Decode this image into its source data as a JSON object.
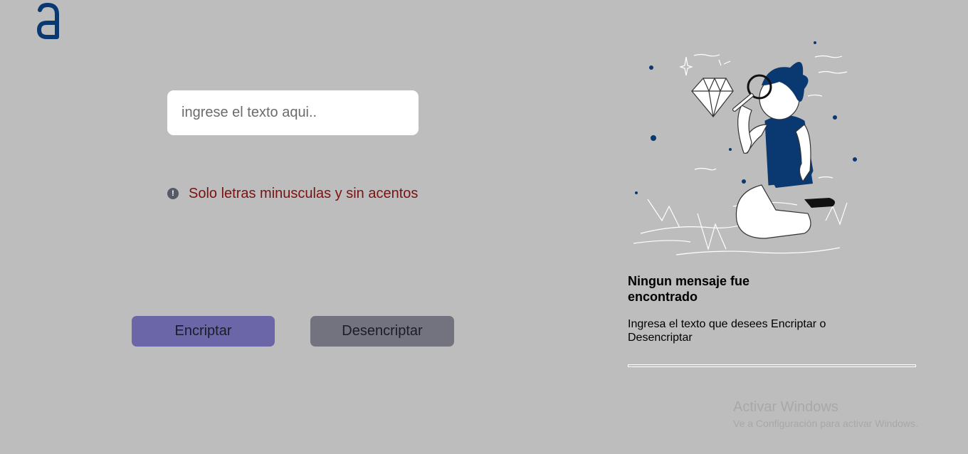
{
  "input": {
    "placeholder": "ingrese el texto aqui.."
  },
  "warning": {
    "icon": "exclamation-circle-icon",
    "text": "Solo letras minusculas y sin acentos"
  },
  "buttons": {
    "encrypt": "Encriptar",
    "decrypt": "Desencriptar"
  },
  "result": {
    "title": "Ningun mensaje fue encontrado",
    "subtitle": "Ingresa el texto que desees Encriptar o Desencriptar"
  },
  "watermark": {
    "title": "Activar Windows",
    "subtitle": "Ve a Configuración para activar Windows."
  },
  "colors": {
    "background": "#bdbdbd",
    "brand": "#0a3871",
    "encrypt_button": "#6a66a8",
    "decrypt_button": "#72737f",
    "warning_text": "#7a1212"
  }
}
